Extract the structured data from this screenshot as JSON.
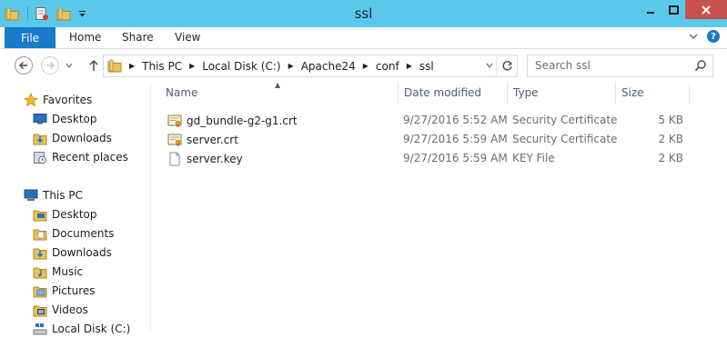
{
  "window": {
    "title": "ssl",
    "minimize_glyph": "—",
    "maximize_glyph": "▢",
    "close_glyph": "✕"
  },
  "ribbon": {
    "file_tab": "File",
    "tabs": [
      "Home",
      "Share",
      "View"
    ],
    "help_glyph": "?"
  },
  "address": {
    "crumbs": [
      "This PC",
      "Local Disk (C:)",
      "Apache24",
      "conf",
      "ssl"
    ]
  },
  "search": {
    "placeholder": "Search ssl"
  },
  "nav_pane": {
    "favorites": {
      "label": "Favorites",
      "items": [
        {
          "label": "Desktop",
          "icon": "desktop-icon"
        },
        {
          "label": "Downloads",
          "icon": "downloads-icon"
        },
        {
          "label": "Recent places",
          "icon": "recent-places-icon"
        }
      ]
    },
    "this_pc": {
      "label": "This PC",
      "items": [
        {
          "label": "Desktop",
          "icon": "desktop-folder-icon"
        },
        {
          "label": "Documents",
          "icon": "documents-icon"
        },
        {
          "label": "Downloads",
          "icon": "downloads-icon"
        },
        {
          "label": "Music",
          "icon": "music-icon"
        },
        {
          "label": "Pictures",
          "icon": "pictures-icon"
        },
        {
          "label": "Videos",
          "icon": "videos-icon"
        },
        {
          "label": "Local Disk (C:)",
          "icon": "drive-icon"
        }
      ]
    }
  },
  "columns": {
    "name": "Name",
    "date": "Date modified",
    "type": "Type",
    "size": "Size"
  },
  "files": [
    {
      "name": "gd_bundle-g2-g1.crt",
      "date": "9/27/2016 5:52 AM",
      "type": "Security Certificate",
      "size": "5 KB",
      "icon": "certificate-icon"
    },
    {
      "name": "server.crt",
      "date": "9/27/2016 5:59 AM",
      "type": "Security Certificate",
      "size": "2 KB",
      "icon": "certificate-icon"
    },
    {
      "name": "server.key",
      "date": "9/27/2016 5:59 AM",
      "type": "KEY File",
      "size": "2 KB",
      "icon": "file-icon"
    }
  ],
  "colors": {
    "titlebar": "#5ac8ea",
    "file_tab": "#1979ca",
    "close_button": "#c75050",
    "folder": "#e8c25a"
  }
}
